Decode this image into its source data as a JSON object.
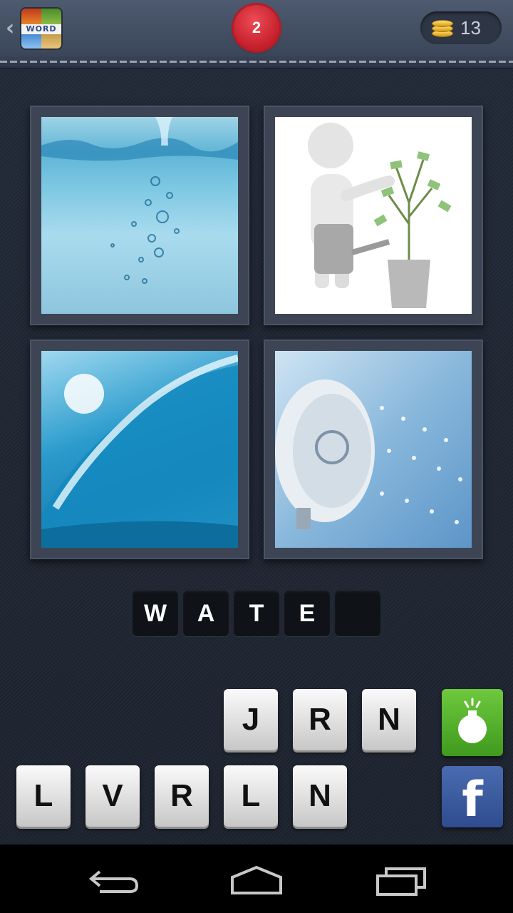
{
  "header": {
    "back_glyph": "‹",
    "logo_text": "WORD",
    "level": "2",
    "coins": "13"
  },
  "puzzle": {
    "pictures": [
      {
        "icon": "water-splash-picture"
      },
      {
        "icon": "watering-money-plant-picture"
      },
      {
        "icon": "ocean-wave-picture"
      },
      {
        "icon": "shower-head-picture"
      }
    ],
    "answer_slots": [
      "W",
      "A",
      "T",
      "E",
      ""
    ]
  },
  "letters": {
    "row1": [
      "J",
      "R",
      "N"
    ],
    "row2": [
      "L",
      "V",
      "R",
      "L",
      "N"
    ]
  },
  "actions": {
    "bomb_icon": "bomb-icon",
    "facebook_label": "f"
  },
  "colors": {
    "level_badge": "#d02a35",
    "bomb_button": "#4fae2a",
    "facebook_button": "#3b5998"
  }
}
